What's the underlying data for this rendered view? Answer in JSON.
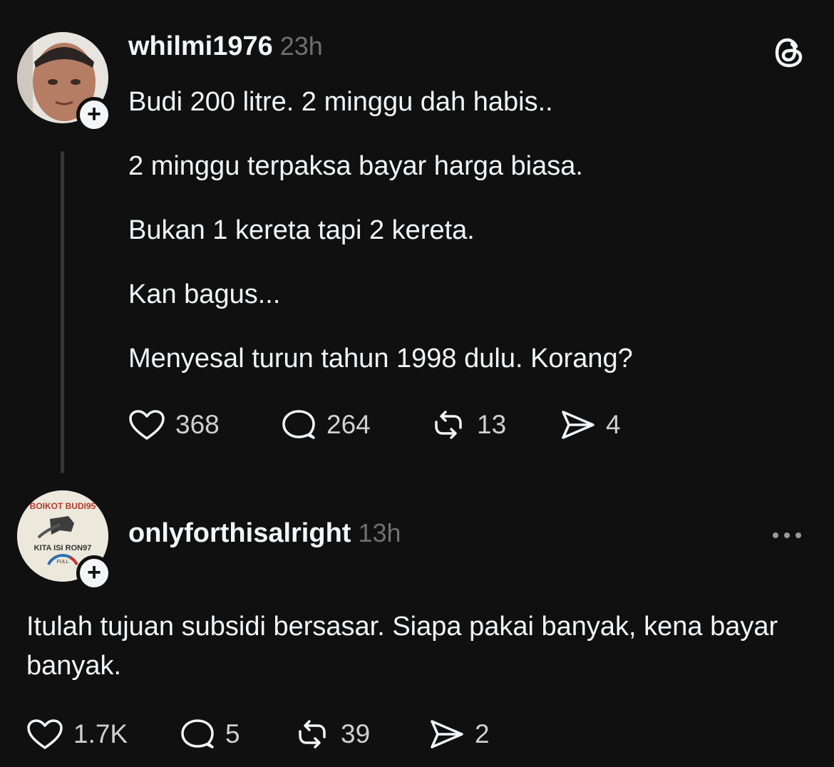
{
  "post": {
    "username": "whilmi1976",
    "time": "23h",
    "lines": [
      "Budi 200 litre. 2 minggu dah habis..",
      "2 minggu terpaksa bayar harga  biasa.",
      "Bukan 1 kereta tapi 2 kereta.",
      "Kan bagus...",
      "Menyesal turun tahun 1998 dulu.  Korang?"
    ],
    "likes": "368",
    "replies": "264",
    "reposts": "13",
    "shares": "4"
  },
  "reply": {
    "username": "onlyforthisalright",
    "time": "13h",
    "avatar_text": {
      "top": "BOIKOT BUDI95",
      "bottom": "KITA ISI RON97",
      "gauge": "FULL"
    },
    "text": "Itulah tujuan subsidi bersasar. Siapa pakai banyak, kena bayar banyak.",
    "likes": "1.7K",
    "replies": "5",
    "reposts": "39",
    "shares": "2"
  },
  "icons": {
    "brand": "threads-logo-icon",
    "plus": "plus-icon",
    "like": "heart-icon",
    "reply": "comment-icon",
    "repost": "repost-icon",
    "share": "send-icon",
    "more": "more-icon"
  },
  "colors": {
    "background": "#101010",
    "text": "#f3f5f7",
    "muted": "#6f6f6f"
  }
}
